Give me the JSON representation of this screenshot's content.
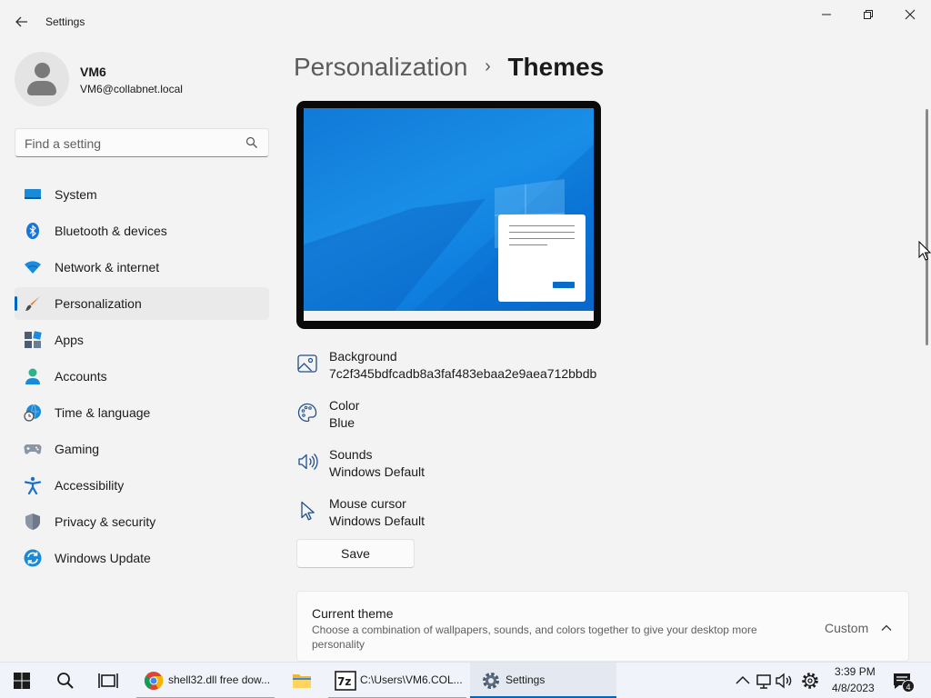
{
  "window": {
    "title": "Settings",
    "back_icon": "back-arrow-icon",
    "controls": [
      "minimize-icon",
      "maximize-icon",
      "close-icon"
    ]
  },
  "profile": {
    "name": "VM6",
    "email": "VM6@collabnet.local"
  },
  "search": {
    "placeholder": "Find a setting",
    "value": "",
    "icon": "search-icon"
  },
  "sidebar": {
    "items": [
      {
        "label": "System",
        "icon": "system-monitor-icon",
        "active": false
      },
      {
        "label": "Bluetooth & devices",
        "icon": "bluetooth-icon",
        "active": false
      },
      {
        "label": "Network & internet",
        "icon": "wifi-icon",
        "active": false
      },
      {
        "label": "Personalization",
        "icon": "paintbrush-icon",
        "active": true
      },
      {
        "label": "Apps",
        "icon": "apps-icon",
        "active": false
      },
      {
        "label": "Accounts",
        "icon": "accounts-icon",
        "active": false
      },
      {
        "label": "Time & language",
        "icon": "time-language-icon",
        "active": false
      },
      {
        "label": "Gaming",
        "icon": "gamepad-icon",
        "active": false
      },
      {
        "label": "Accessibility",
        "icon": "accessibility-icon",
        "active": false
      },
      {
        "label": "Privacy & security",
        "icon": "shield-icon",
        "active": false
      },
      {
        "label": "Windows Update",
        "icon": "update-icon",
        "active": false
      }
    ]
  },
  "header": {
    "parent": "Personalization",
    "separator": "›",
    "current": "Themes"
  },
  "theme_properties": [
    {
      "label": "Background",
      "value": "7c2f345bdfcadb8a3faf483ebaa2e9aea712bbdb",
      "icon": "picture-icon"
    },
    {
      "label": "Color",
      "value": "Blue",
      "icon": "palette-icon"
    },
    {
      "label": "Sounds",
      "value": "Windows Default",
      "icon": "speaker-icon"
    },
    {
      "label": "Mouse cursor",
      "value": "Windows Default",
      "icon": "mouse-cursor-icon"
    }
  ],
  "actions": {
    "save_label": "Save"
  },
  "current_theme": {
    "title": "Current theme",
    "description": "Choose a combination of wallpapers, sounds, and colors together to give your desktop more personality",
    "value": "Custom",
    "icon": "chevron-up-icon"
  },
  "taskbar": {
    "start_icon": "windows-start-icon",
    "search_icon": "search-icon",
    "task_view_icon": "task-view-icon",
    "tasks": [
      {
        "label": "shell32.dll free dow...",
        "icon": "chrome-icon"
      },
      {
        "label": "",
        "icon": "file-explorer-icon"
      },
      {
        "label": "C:\\Users\\VM6.COL...",
        "icon": "7zip-icon"
      },
      {
        "label": "Settings",
        "icon": "settings-gear-icon"
      }
    ],
    "tray": {
      "icons": [
        "chevron-up-icon",
        "network-icon",
        "volume-icon",
        "gear-icon"
      ],
      "time": "3:39 PM",
      "date": "4/8/2023",
      "notification_count": "4",
      "notification_icon": "notification-icon"
    }
  },
  "colors": {
    "accent": "#0067c0",
    "background": "#f3f3f3",
    "wallpaper": "#0a78dc"
  }
}
